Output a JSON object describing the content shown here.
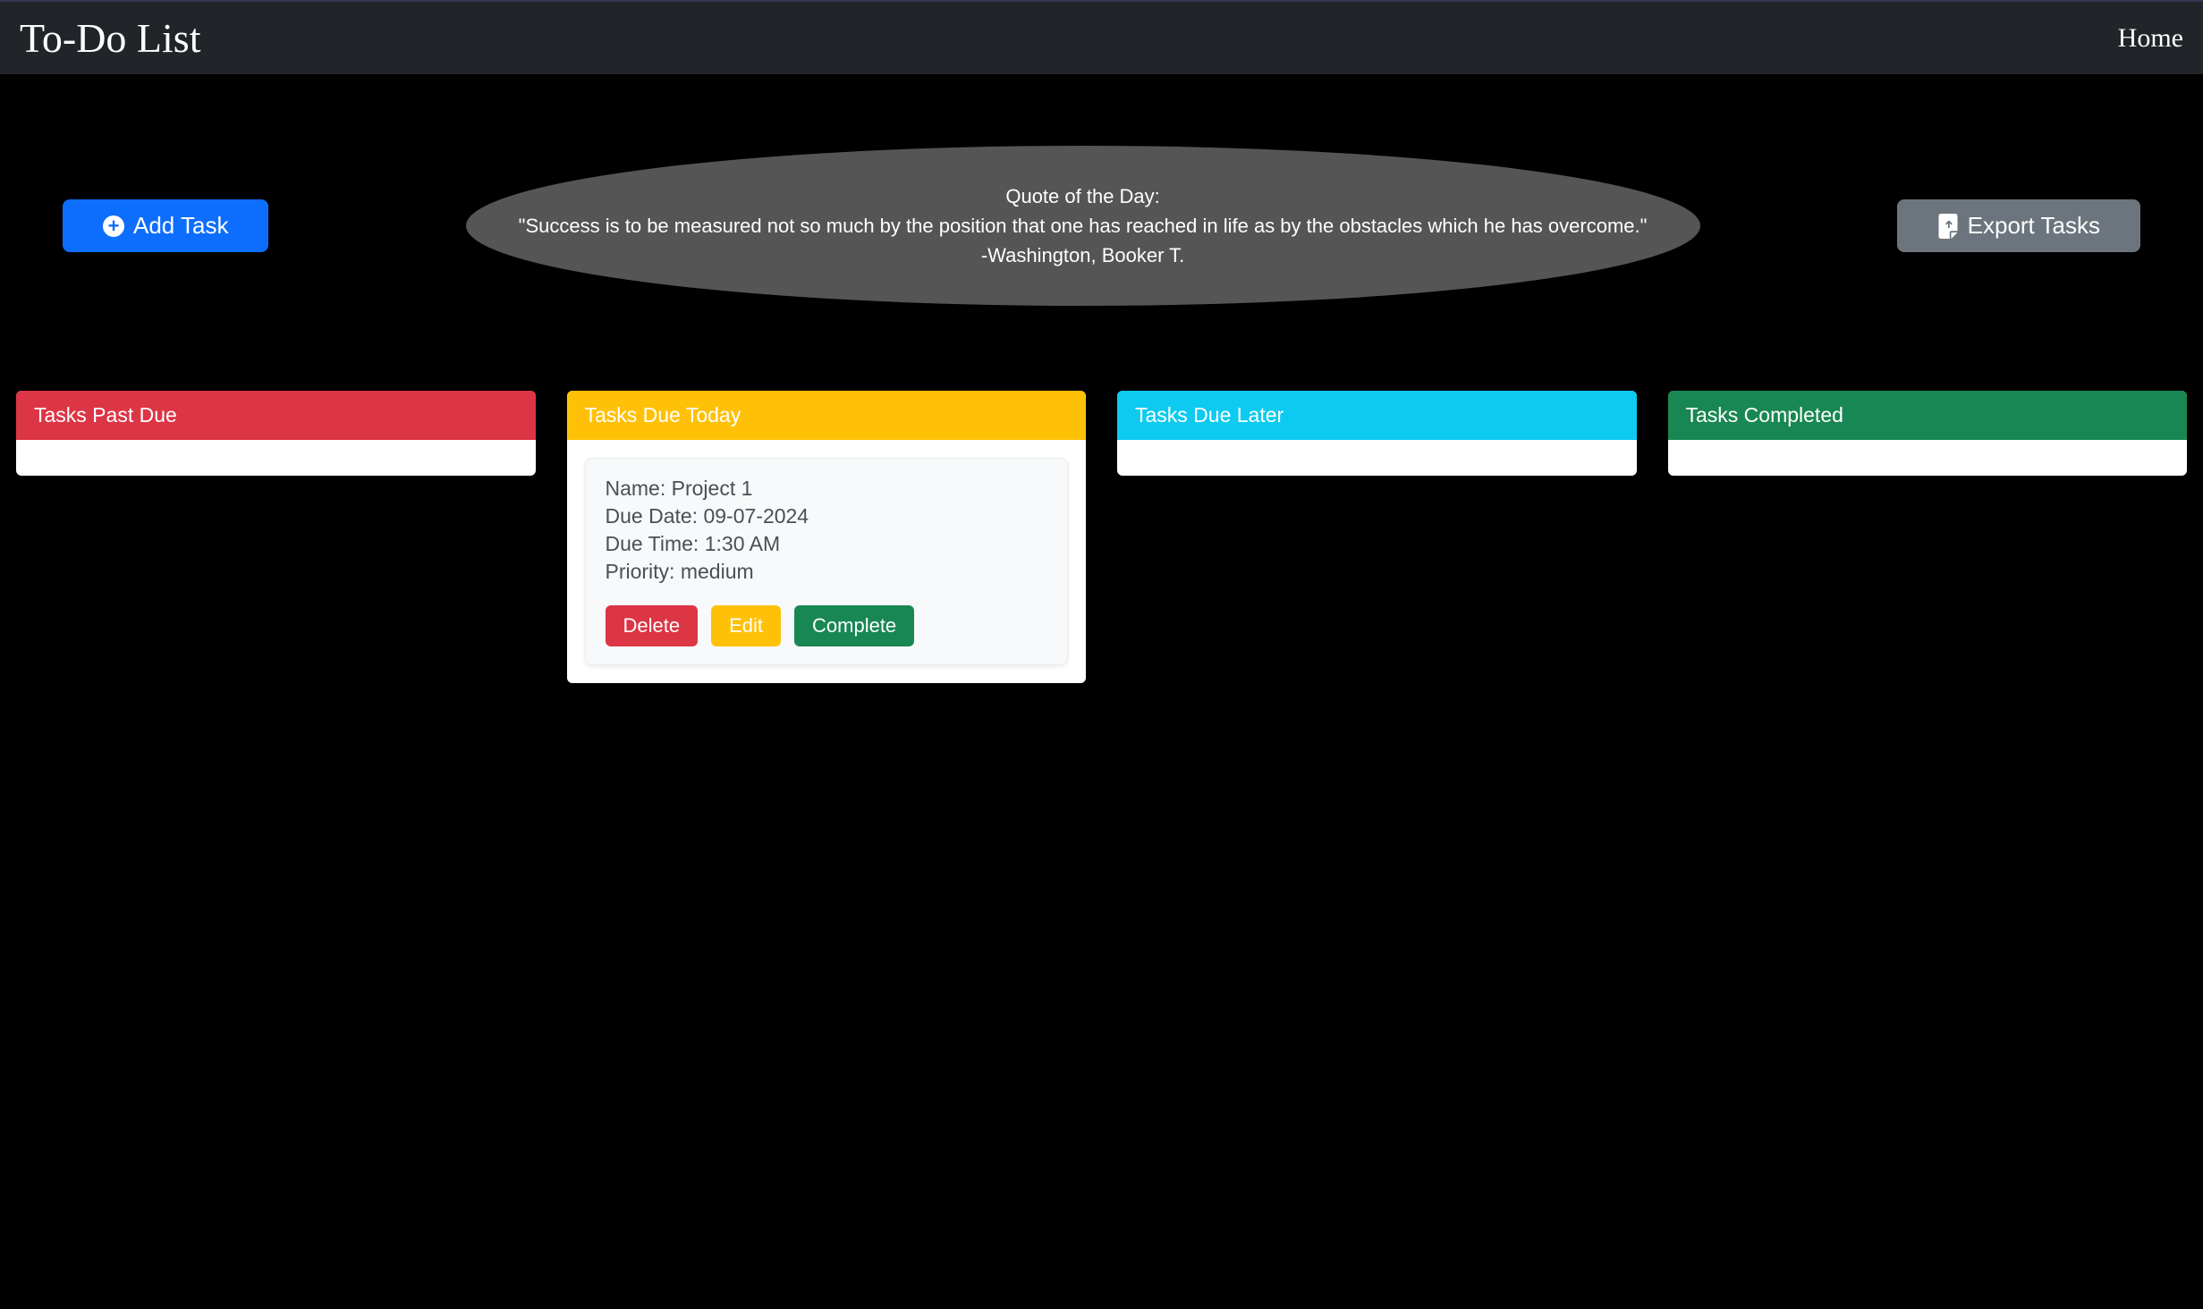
{
  "header": {
    "title": "To-Do List",
    "home_label": "Home"
  },
  "toolbar": {
    "add_task_label": "Add Task",
    "export_tasks_label": "Export Tasks"
  },
  "quote": {
    "heading": "Quote of the Day:",
    "text": "\"Success is to be measured not so much by the position that one has reached in life as by the obstacles which he has overcome.\"",
    "author": "-Washington, Booker T."
  },
  "columns": {
    "past_due": {
      "title": "Tasks Past Due",
      "tasks": []
    },
    "due_today": {
      "title": "Tasks Due Today",
      "tasks": [
        {
          "name_label": "Name: ",
          "name": "Project 1",
          "due_date_label": "Due Date: ",
          "due_date": "09-07-2024",
          "due_time_label": "Due Time: ",
          "due_time": "1:30 AM",
          "priority_label": "Priority: ",
          "priority": "medium",
          "delete_label": "Delete",
          "edit_label": "Edit",
          "complete_label": "Complete"
        }
      ]
    },
    "due_later": {
      "title": "Tasks Due Later",
      "tasks": []
    },
    "completed": {
      "title": "Tasks Completed",
      "tasks": []
    }
  },
  "colors": {
    "primary": "#0d6efd",
    "secondary": "#6c757d",
    "danger": "#dc3545",
    "warning": "#ffc107",
    "info": "#0dcaf0",
    "success": "#198754"
  }
}
